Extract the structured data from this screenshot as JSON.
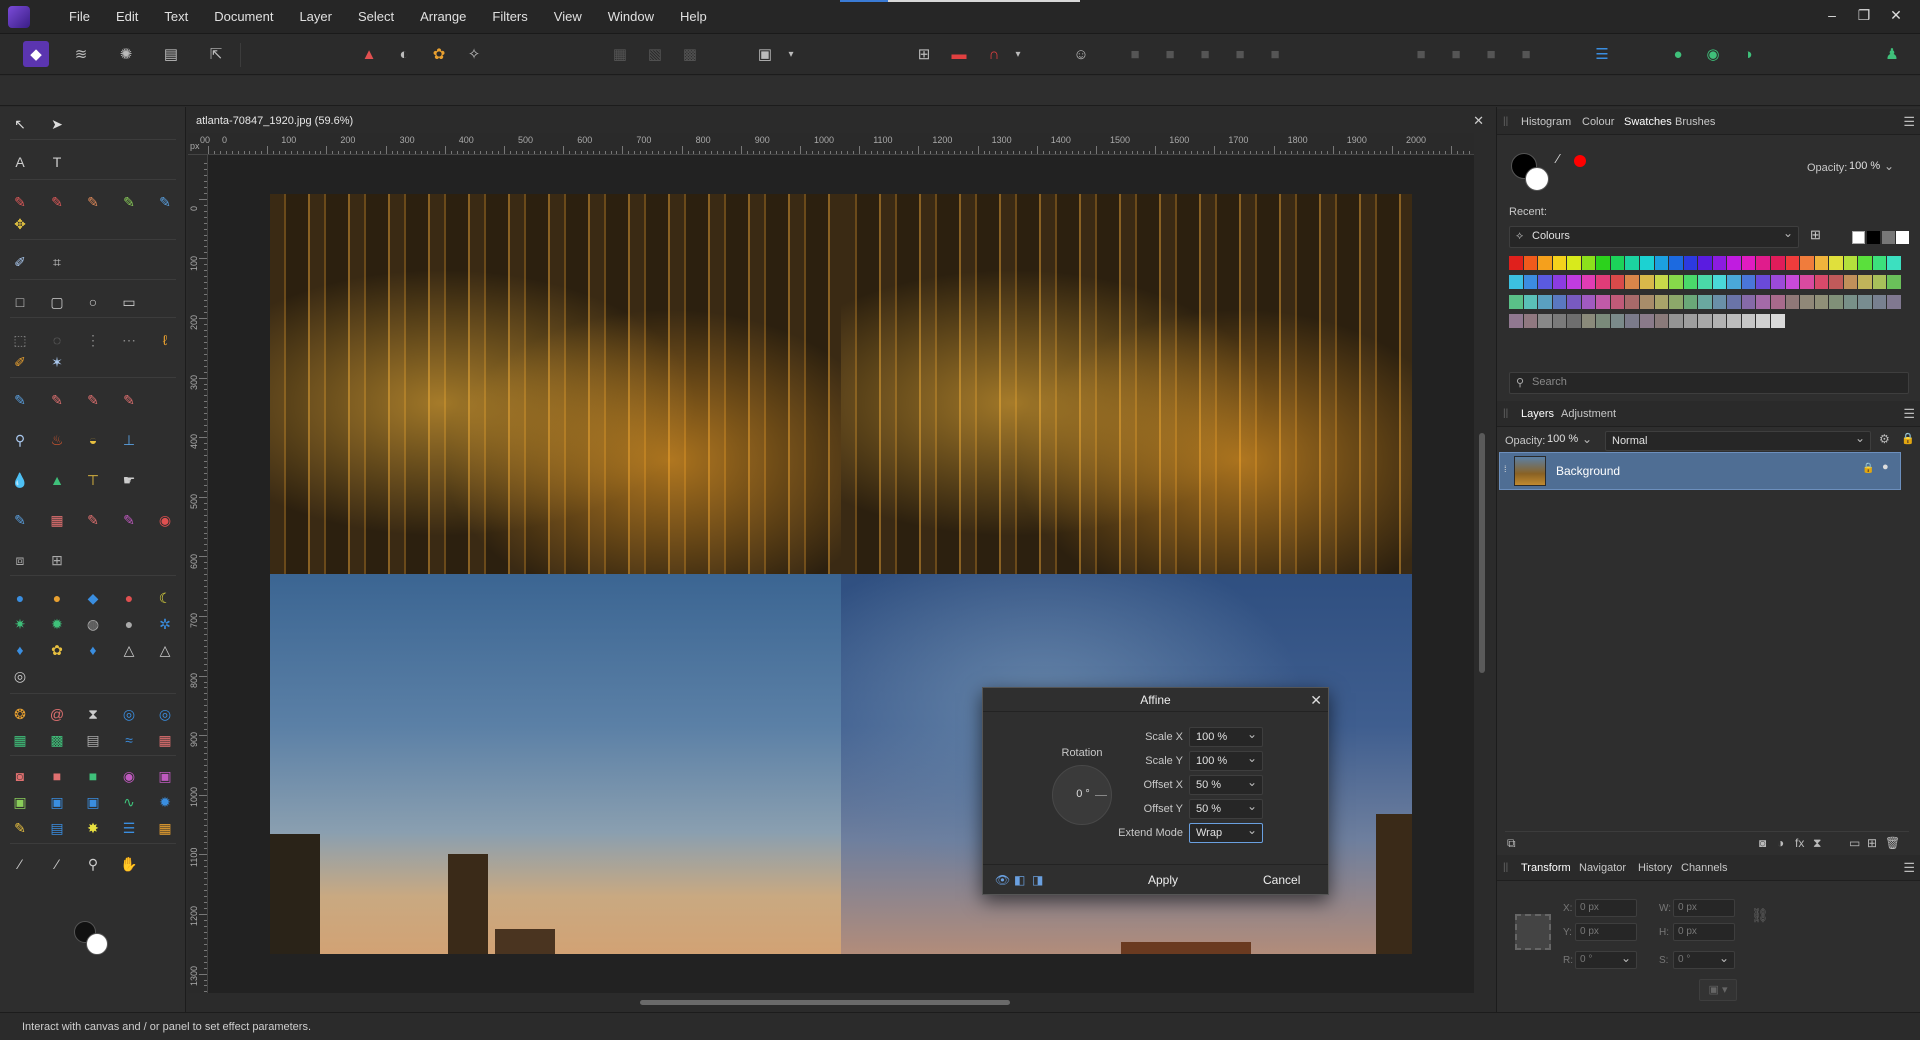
{
  "menubar": {
    "items": [
      "File",
      "Edit",
      "Text",
      "Document",
      "Layer",
      "Select",
      "Arrange",
      "Filters",
      "View",
      "Window",
      "Help"
    ],
    "window_controls": [
      "–",
      "❐",
      "✕"
    ]
  },
  "document": {
    "tab_title": "atlanta-70847_1920.jpg (59.6%)",
    "ruler_unit": "px",
    "ruler_h_labels": [
      "00",
      "0",
      "100",
      "200",
      "300",
      "400",
      "500",
      "600",
      "700",
      "800",
      "900",
      "1000",
      "1100",
      "1200",
      "1300",
      "1400",
      "1500",
      "1600",
      "1700",
      "1800",
      "1900",
      "2000"
    ],
    "ruler_v_labels": [
      "0",
      "100",
      "200",
      "300",
      "400",
      "500",
      "600",
      "700",
      "800",
      "900",
      "1000",
      "1100",
      "1200",
      "1300"
    ]
  },
  "status": {
    "text": "Interact with canvas and / or panel to set effect parameters."
  },
  "swatches_panel": {
    "tabs": [
      "Histogram",
      "Colour",
      "Swatches",
      "Brushes"
    ],
    "active_tab": "Swatches",
    "opacity_label": "Opacity:",
    "opacity_value": "100 %",
    "recent_label": "Recent:",
    "palette_name": "Colours",
    "search_placeholder": "Search",
    "fill_color": "#000000",
    "stroke_color": "#ffffff",
    "recent_color": "#ff0000",
    "swatch_colors": [
      "#e0201c",
      "#f05a1c",
      "#f5a01c",
      "#f5d21c",
      "#d8ea1c",
      "#8ce01c",
      "#2cd21c",
      "#1cd25a",
      "#1cd2a0",
      "#1cd2d2",
      "#1ca0e0",
      "#1c6ae0",
      "#2c3ae0",
      "#5a1ce0",
      "#8c1ce0",
      "#c01ce0",
      "#e01cc0",
      "#e01c8c",
      "#e01c5a",
      "#f03c3c",
      "#f07c3c",
      "#f0b43c",
      "#e0e03c",
      "#b4e03c",
      "#5ae03c",
      "#3ce07c",
      "#3ce0c0",
      "#3cc0e0",
      "#3c8ce0",
      "#5a5ae0",
      "#8c3ce0",
      "#c03ce0",
      "#e03cb4",
      "#e03c78",
      "#d84a4a",
      "#d8864a",
      "#d8b84a",
      "#c8d84a",
      "#86d84a",
      "#4ad86a",
      "#4ad8a8",
      "#4ad8d8",
      "#4aa8d8",
      "#4a76d8",
      "#6a4ad8",
      "#9c4ad8",
      "#c84ad8",
      "#d84aa0",
      "#d84a6a",
      "#c05a5a",
      "#c0905a",
      "#c0b45a",
      "#a8c05a",
      "#6ac05a",
      "#5ac088",
      "#5ac0b8",
      "#5aa0c0",
      "#5a78c0",
      "#785ac0",
      "#a05ac0",
      "#c05aa8",
      "#c05a78",
      "#a86a6a",
      "#a88c6a",
      "#a8a46a",
      "#8ca86a",
      "#6aa878",
      "#6aa8a0",
      "#6a90a8",
      "#6a74a8",
      "#866aa8",
      "#a46aa8",
      "#a86a8c",
      "#907878",
      "#908878",
      "#909078",
      "#809078",
      "#789088",
      "#788c90",
      "#788090",
      "#807890",
      "#907890",
      "#907880",
      "#888888",
      "#7a7a7a",
      "#6e6e6e",
      "#8a8a7a",
      "#7a8a7a",
      "#7a8a8a",
      "#7a7a8a",
      "#8a7a8a",
      "#8a7a7a",
      "#949494",
      "#9e9e9e",
      "#a8a8a8",
      "#b2b2b2",
      "#bcbcbc",
      "#c6c6c6",
      "#d0d0d0",
      "#dadada"
    ]
  },
  "layers_panel": {
    "tabs": [
      "Layers",
      "Adjustment"
    ],
    "active_tab": "Layers",
    "opacity_label": "Opacity:",
    "opacity_value": "100 %",
    "blend_mode": "Normal",
    "layers": [
      {
        "name": "Background"
      }
    ]
  },
  "transform_panel": {
    "tabs": [
      "Transform",
      "Navigator",
      "History",
      "Channels"
    ],
    "active_tab": "Transform",
    "x_label": "X:",
    "x_value": "0 px",
    "y_label": "Y:",
    "y_value": "0 px",
    "w_label": "W:",
    "w_value": "0 px",
    "h_label": "H:",
    "h_value": "0 px",
    "r_label": "R:",
    "r_value": "0 °",
    "s_label": "S:",
    "s_value": "0 °"
  },
  "affine_dialog": {
    "title": "Affine",
    "rotation_label": "Rotation",
    "rotation_value": "0 °",
    "scale_x_label": "Scale X",
    "scale_x_value": "100 %",
    "scale_y_label": "Scale Y",
    "scale_y_value": "100 %",
    "offset_x_label": "Offset X",
    "offset_x_value": "50 %",
    "offset_y_label": "Offset Y",
    "offset_y_value": "50 %",
    "extend_mode_label": "Extend Mode",
    "extend_mode_value": "Wrap",
    "apply_label": "Apply",
    "cancel_label": "Cancel"
  }
}
